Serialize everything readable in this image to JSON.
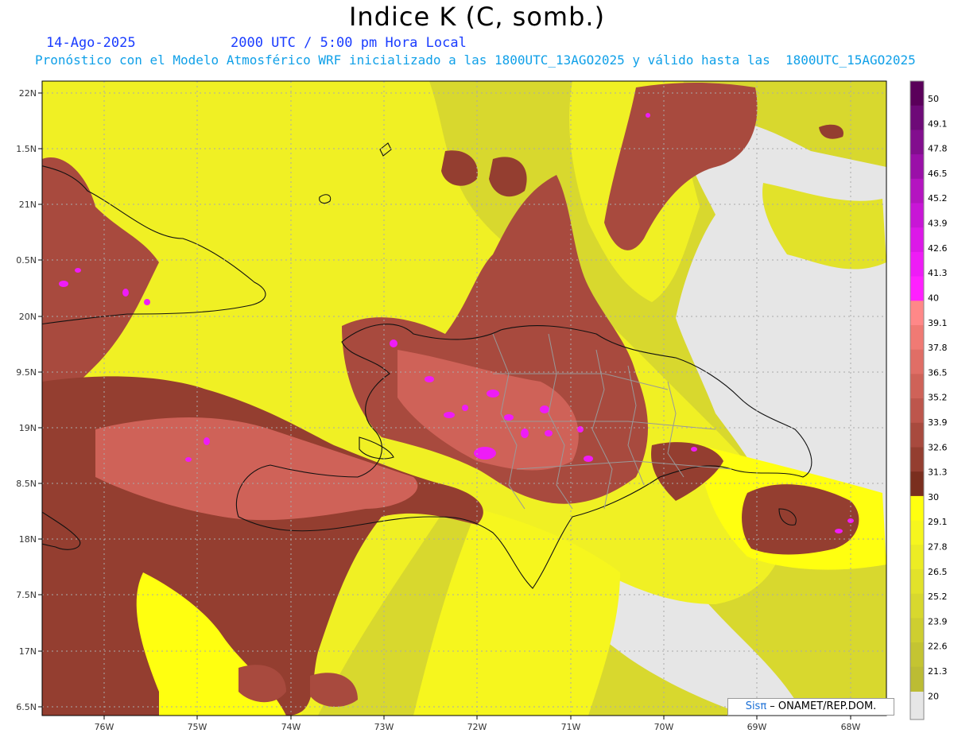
{
  "header": {
    "title": "Indice K (C, somb.)",
    "date": "14-Ago-2025",
    "time": "2000 UTC / 5:00 pm Hora Local",
    "forecast_line": "Pronóstico con el Modelo Atmosférico WRF inicializado a las 1800UTC_13AGO2025 y válido hasta las  1800UTC_15AGO2025"
  },
  "map": {
    "lat_labels": [
      "22N",
      "1.5N",
      "21N",
      "0.5N",
      "20N",
      "9.5N",
      "19N",
      "8.5N",
      "18N",
      "7.5N",
      "17N",
      "6.5N"
    ],
    "lon_labels": [
      "76W",
      "75W",
      "74W",
      "73W",
      "72W",
      "71W",
      "70W",
      "69W",
      "68W"
    ]
  },
  "colorbar": {
    "labels": [
      "50",
      "49.1",
      "47.8",
      "46.5",
      "45.2",
      "43.9",
      "42.6",
      "41.3",
      "40",
      "39.1",
      "37.8",
      "36.5",
      "35.2",
      "33.9",
      "32.6",
      "31.3",
      "30",
      "29.1",
      "27.8",
      "26.5",
      "25.2",
      "23.9",
      "22.6",
      "21.3",
      "20"
    ],
    "colors": [
      "#5a005a",
      "#6e0a78",
      "#820e8e",
      "#9a10a8",
      "#b414c0",
      "#c816d6",
      "#dc18e8",
      "#ee1cf6",
      "#ff20ff",
      "#ff8888",
      "#f07a74",
      "#e06e66",
      "#cf6258",
      "#bd564c",
      "#a84a3e",
      "#943e30",
      "#7a2e1e",
      "#ffff10",
      "#f6f61e",
      "#ecec24",
      "#e2e22a",
      "#d8d82e",
      "#cece30",
      "#c4c432",
      "#bcbc34"
    ],
    "land_color": "#e6e6e6"
  },
  "credit": {
    "brand": "Sisπ",
    "text": " – ONAMET/REP.DOM."
  }
}
